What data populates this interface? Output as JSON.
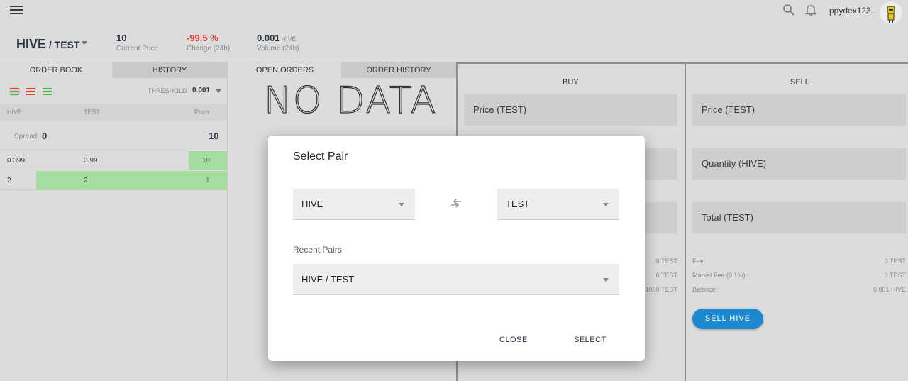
{
  "header": {
    "pair_base": "HIVE",
    "pair_sep_quote": " / TEST",
    "price": "10",
    "price_label": "Current Price",
    "change": "-99.5 %",
    "change_label": "Change (24h)",
    "volume": "0.001",
    "volume_unit": "HIVE",
    "volume_label": "Volume (24h)",
    "username": "ppydex123"
  },
  "left": {
    "tabs": [
      "ORDER BOOK",
      "HISTORY"
    ],
    "threshold_label": "THRESHOLD",
    "threshold_value": "0.001",
    "columns": [
      "HIVE",
      "TEST",
      "Price"
    ],
    "spread_label": "Spread",
    "spread_value": "0",
    "spread_price": "10",
    "rows": [
      {
        "hive": "0.399",
        "test": "3.99",
        "price": "10"
      },
      {
        "hive": "2",
        "test": "2",
        "price": "1"
      }
    ]
  },
  "middle": {
    "tabs": [
      "OPEN ORDERS",
      "ORDER HISTORY"
    ],
    "empty_text": "NO DATA"
  },
  "buy": {
    "title": "BUY",
    "price_field": "Price (TEST)",
    "values": [
      "0 TEST",
      "0 TEST",
      "1000 TEST"
    ]
  },
  "sell": {
    "title": "SELL",
    "price_field": "Price (TEST)",
    "quantity_field": "Quantity (HIVE)",
    "total_field": "Total (TEST)",
    "fee_label": "Fee:",
    "fee_value": "0 TEST",
    "market_fee_label": "Market Fee (0.1%):",
    "market_fee_value": "0 TEST",
    "balance_label": "Balance:",
    "balance_value": "0.001 HIVE",
    "button": "SELL HIVE"
  },
  "modal": {
    "title": "Select Pair",
    "base": "HIVE",
    "quote": "TEST",
    "recent_label": "Recent Pairs",
    "recent_value": "HIVE / TEST",
    "close": "CLOSE",
    "select": "SELECT"
  },
  "colors": {
    "accent": "#1e88cf",
    "negative": "#e53935",
    "bid_fill": "#a5dca0"
  }
}
